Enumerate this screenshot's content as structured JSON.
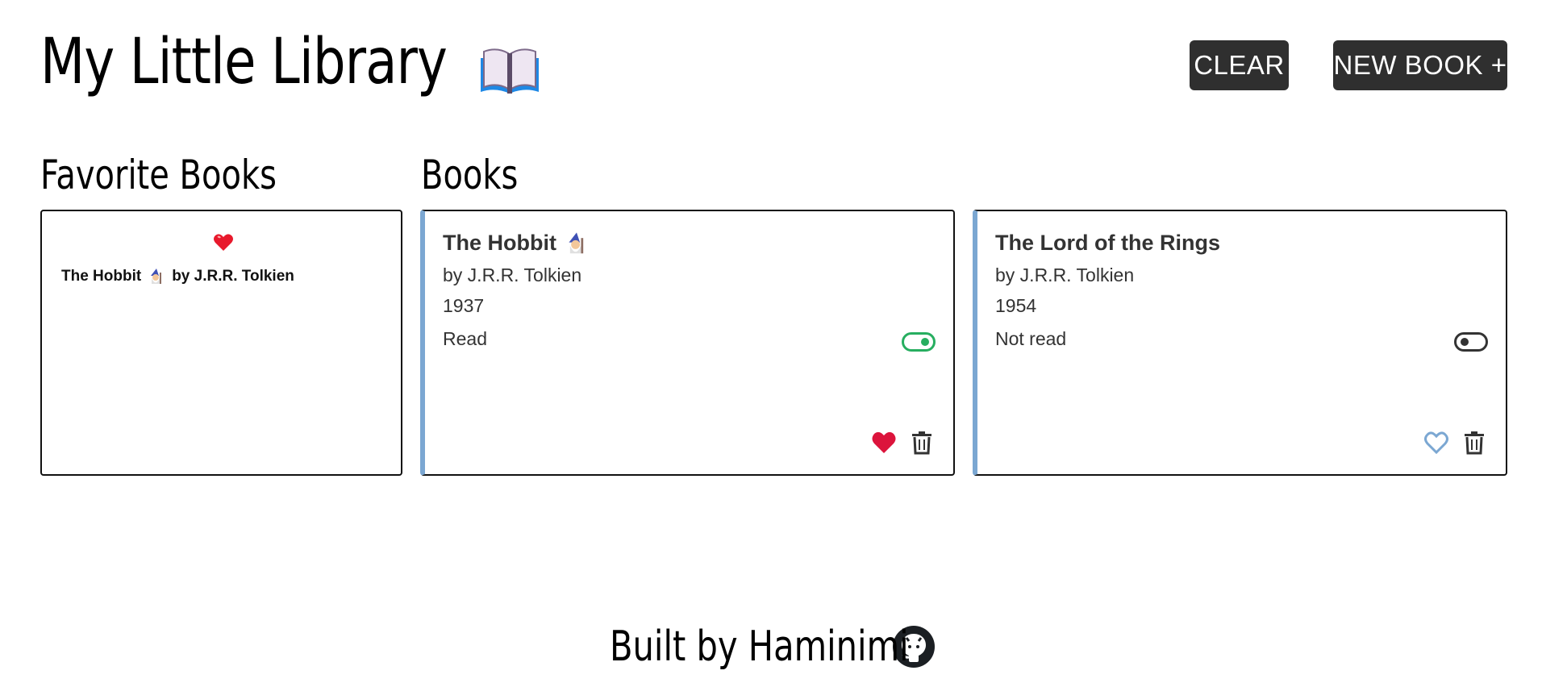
{
  "header": {
    "title": "My Little Library",
    "clear_label": "CLEAR",
    "new_book_label": "NEW BOOK +"
  },
  "favorites": {
    "title": "Favorite Books",
    "items": [
      {
        "title": "The Hobbit",
        "author": "by J.R.R. Tolkien",
        "icon": "wizard-icon"
      }
    ]
  },
  "books": {
    "title": "Books",
    "items": [
      {
        "title": "The Hobbit",
        "author": "by J.R.R. Tolkien",
        "year": "1937",
        "status": "Read",
        "read": true,
        "favorite": true,
        "icon": "wizard-icon"
      },
      {
        "title": "The Lord of the Rings",
        "author": "by J.R.R. Tolkien",
        "year": "1954",
        "status": "Not read",
        "read": false,
        "favorite": false
      }
    ]
  },
  "footer": {
    "text": "Built by Haminimi",
    "icon": "github-icon"
  },
  "colors": {
    "button_bg": "#2f2f2f",
    "card_accent": "#7ba7d2",
    "toggle_on": "#27ae60",
    "heart_filled": "#dc143c",
    "heart_outline": "#7ba7d2"
  }
}
